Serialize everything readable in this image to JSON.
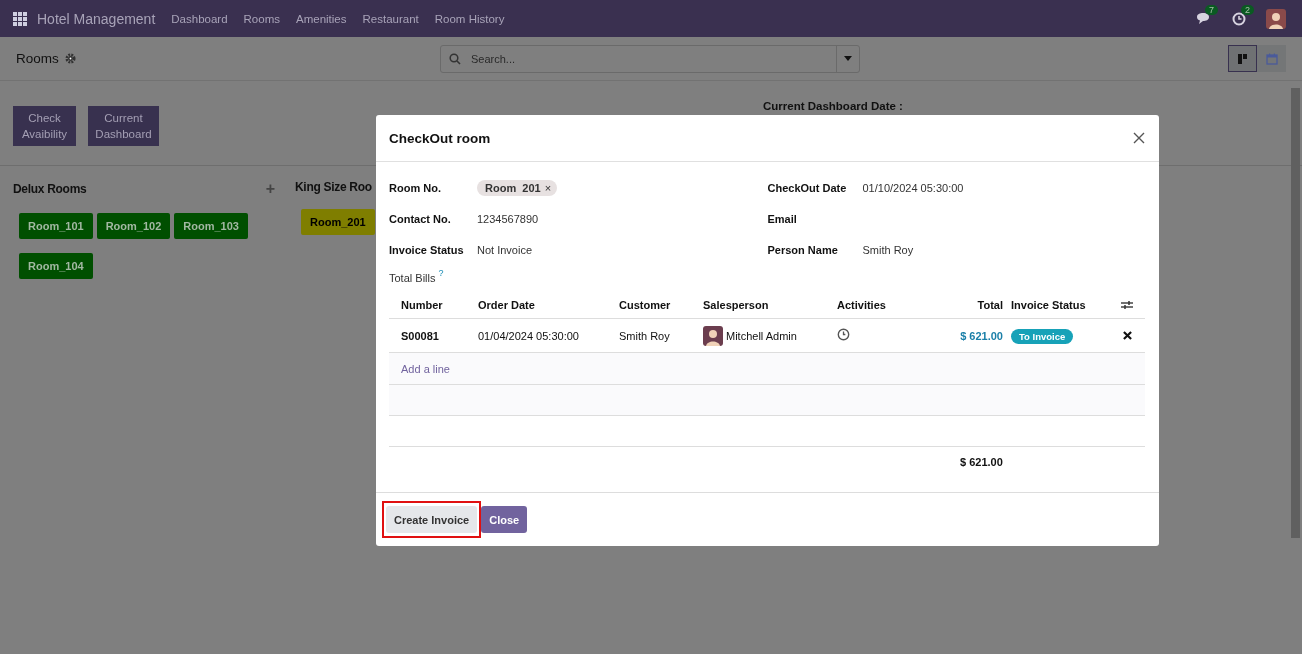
{
  "navbar": {
    "app_name": "Hotel Management",
    "menu": [
      "Dashboard",
      "Rooms",
      "Amenities",
      "Restaurant",
      "Room History"
    ],
    "chat_badge": "7",
    "activity_badge": "2"
  },
  "control_panel": {
    "breadcrumb": "Rooms",
    "search_placeholder": "Search...",
    "views": [
      {
        "kind": "kanban",
        "selected": true
      },
      {
        "kind": "calendar",
        "selected": false
      }
    ]
  },
  "actions": [
    "Check Avaibility",
    "Current Dashboard"
  ],
  "dashboard_date_label": "Current Dashboard Date :",
  "room_groups": [
    {
      "name": "Delux Rooms",
      "add": "+",
      "rooms": [
        {
          "label": "Room_101",
          "color": "#004f00"
        },
        {
          "label": "Room_102",
          "color": "#004f00"
        },
        {
          "label": "Room_103",
          "color": "#004f00"
        },
        {
          "label": "Room_104",
          "color": "#004f00"
        }
      ]
    },
    {
      "name": "King Size Roo",
      "rooms": [
        {
          "label": "Room_201",
          "color": "#7f7e00"
        }
      ]
    }
  ],
  "dialog": {
    "title": "CheckOut room",
    "fields_left": [
      {
        "label": "Room No.",
        "kind": "tag",
        "value": "Room  201",
        "remove": "×"
      },
      {
        "label": "Contact No.",
        "kind": "text",
        "value": "1234567890"
      },
      {
        "label": "Invoice Status",
        "kind": "text",
        "value": "Not Invoice"
      }
    ],
    "fields_right": [
      {
        "label": "CheckOut Date",
        "kind": "text",
        "value": "01/10/2024 05:30:00"
      },
      {
        "label": "Email",
        "kind": "text"
      },
      {
        "label": "Person Name",
        "kind": "text",
        "value": "Smith Roy"
      }
    ],
    "bills_label": "Total Bills",
    "bills_help": "?",
    "table": {
      "columns": [
        "Number",
        "Order Date",
        "Customer",
        "Salesperson",
        "Activities",
        "Total",
        "Invoice Status"
      ],
      "rows": [
        {
          "number": "S00081",
          "order_date": "01/04/2024 05:30:00",
          "customer": "Smith Roy",
          "salesperson": "Mitchell Admin",
          "total": "$ 621.00",
          "invoice_status": "To Invoice"
        }
      ],
      "add_line": "Add a line",
      "footer_total": "$ 621.00"
    },
    "buttons": [
      {
        "label": "Create Invoice",
        "kind": "secondary",
        "highlighted": true
      },
      {
        "label": "Close",
        "kind": "primary",
        "highlighted": false
      }
    ]
  }
}
